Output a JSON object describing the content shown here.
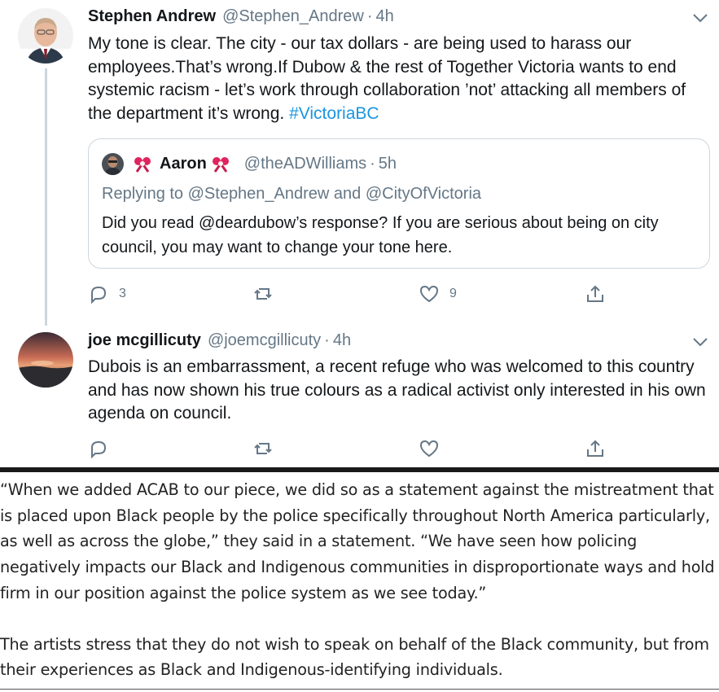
{
  "tweet1": {
    "name": "Stephen Andrew",
    "handle": "@Stephen_Andrew",
    "separator": "·",
    "time": "4h",
    "text": "My tone is clear.   The city - our tax dollars - are being used to harass our employees.That’s wrong.If Dubow & the rest of Together Victoria wants to end systemic racism - let’s work through collaboration ’not’ attacking all members of the department it’s wrong. ",
    "hashtag": "#VictoriaBC",
    "quote": {
      "name": "Aaron",
      "handle": "@theADWilliams",
      "separator": "·",
      "time": "5h",
      "replying": "Replying to @Stephen_Andrew and @CityOfVictoria",
      "text": "Did you read @deardubow’s response? If you are serious about being on city council, you may want to change your tone here."
    },
    "actions": {
      "reply_count": "3",
      "retweet_count": "",
      "like_count": "9"
    }
  },
  "tweet2": {
    "name": "joe mcgillicuty",
    "handle": "@joemcgillicuty",
    "separator": "·",
    "time": "4h",
    "text": "Dubois is an embarrassment, a recent refuge who was welcomed to this country and has now shown his true colours as a radical activist only interested in his own agenda on council.",
    "actions": {
      "reply_count": "",
      "retweet_count": "",
      "like_count": ""
    }
  },
  "article": {
    "paragraph1": "“When we added ACAB to our piece, we did so as a statement against the mistreatment that is placed upon Black people by the police specifically throughout North America particularly, as well as across the globe,” they said in a statement. “We have seen how policing negatively impacts our Black and Indigenous communities in disproportionate ways and hold firm in our position against the police system as we see today.”",
    "paragraph2": "The artists stress that they do not wish to speak on behalf of the Black community, but from their experiences as Black and Indigenous-identifying individuals."
  },
  "colors": {
    "link": "#1b95e0",
    "secondary_text": "#657786",
    "border": "#ccd6dd",
    "quote_emoji": "#e0245e"
  },
  "icons": [
    "reply-icon",
    "retweet-icon",
    "like-icon",
    "share-icon",
    "chevron-down-icon",
    "ribbon-emoji-icon"
  ]
}
